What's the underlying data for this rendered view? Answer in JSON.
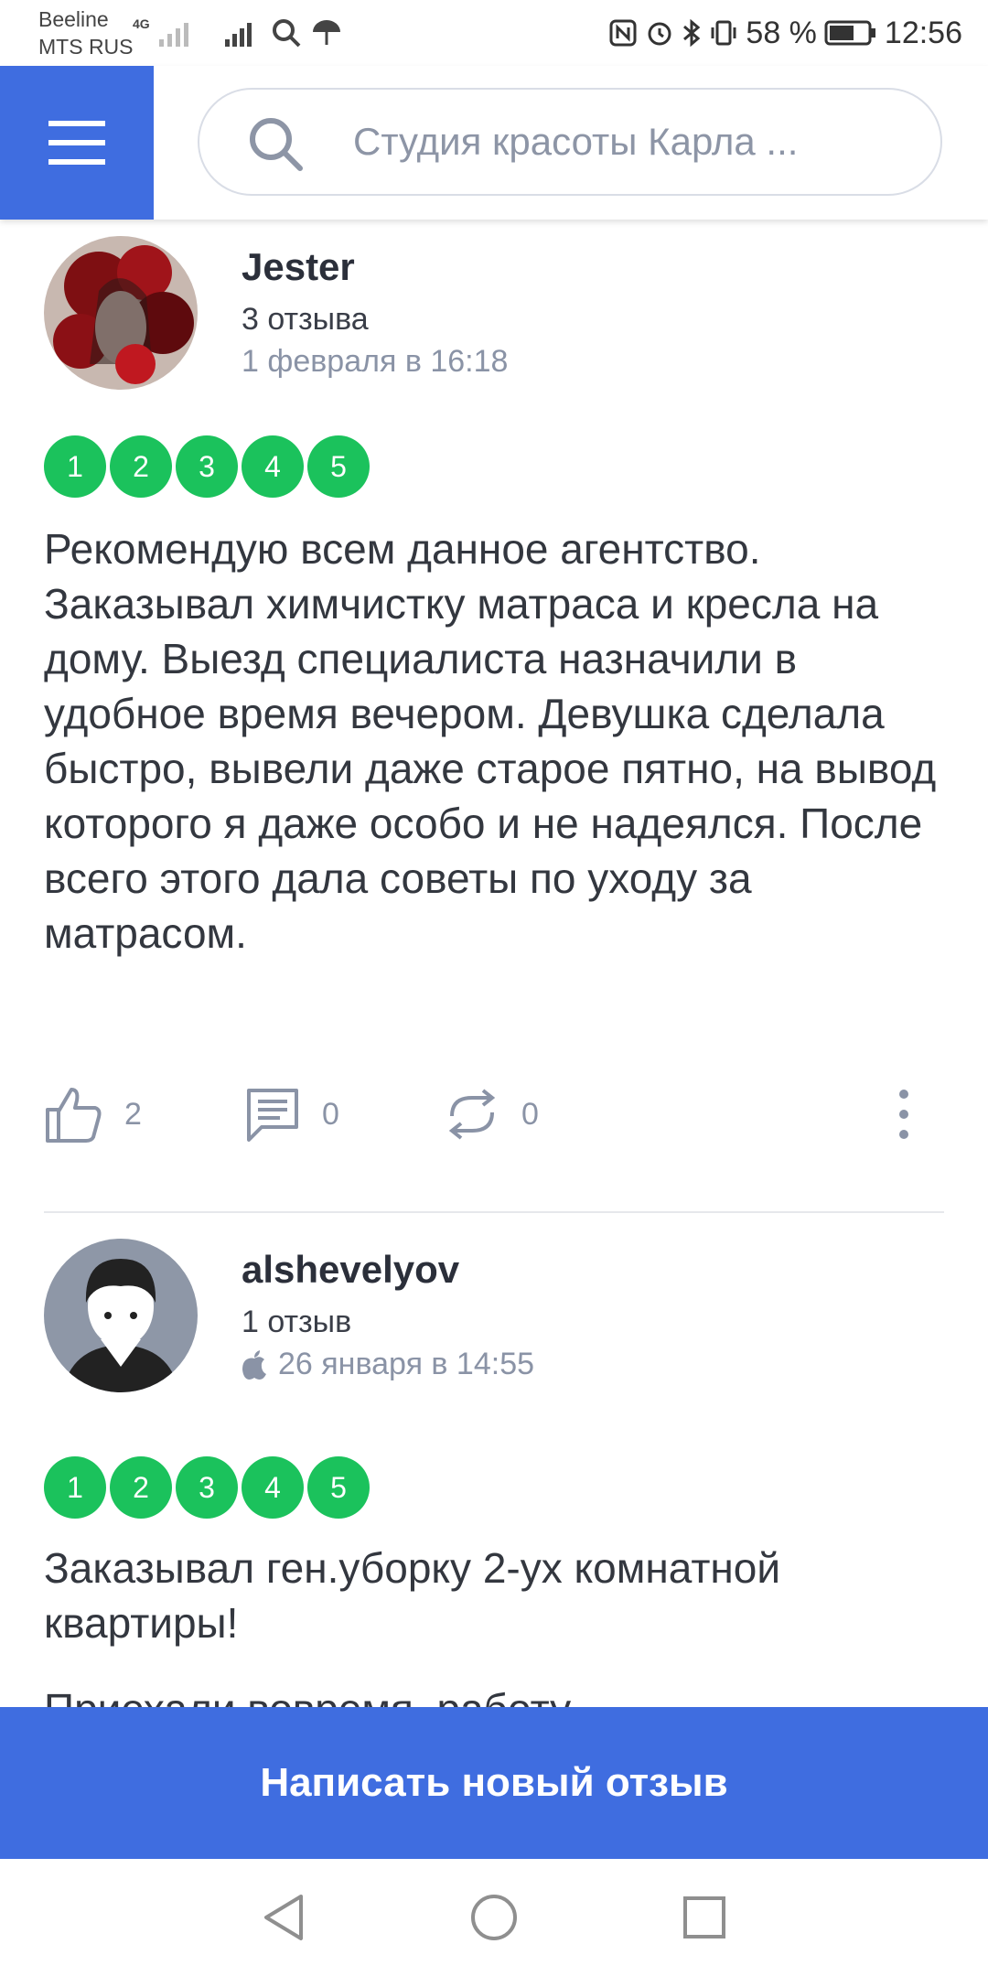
{
  "status_bar": {
    "carrier_1": "Beeline",
    "carrier_2": "MTS RUS",
    "network": "4G",
    "battery": "58 %",
    "time": "12:56"
  },
  "header": {
    "search_placeholder": "Студия красоты Карла ..."
  },
  "reviews": [
    {
      "author": "Jester",
      "count": "3 отзыва",
      "date": "1 февраля в 16:18",
      "rating_options": [
        "1",
        "2",
        "3",
        "4",
        "5"
      ],
      "text": "Рекомендую всем данное агентство. Заказывал химчистку матраса и кресла на дому. Выезд специалиста назначили в удобное время вечером. Девушка сделала быстро, вывели даже старое пятно, на вывод которого я даже особо и не надеялся. После всего этого дала советы по уходу за матрасом.",
      "likes": "2",
      "comments": "0",
      "reposts": "0"
    },
    {
      "author": "alshevelyov",
      "count": "1 отзыв",
      "date": "26 января в 14:55",
      "rating_options": [
        "1",
        "2",
        "3",
        "4",
        "5"
      ],
      "text": "Заказывал ген.уборку 2-ух комнатной квартиры!",
      "text_cut": "Приехали вовремя, работу"
    }
  ],
  "cta": {
    "label": "Написать новый отзыв"
  },
  "colors": {
    "accent": "#3f6de0",
    "rating_green": "#1bc25c",
    "muted": "#8a93a6"
  }
}
